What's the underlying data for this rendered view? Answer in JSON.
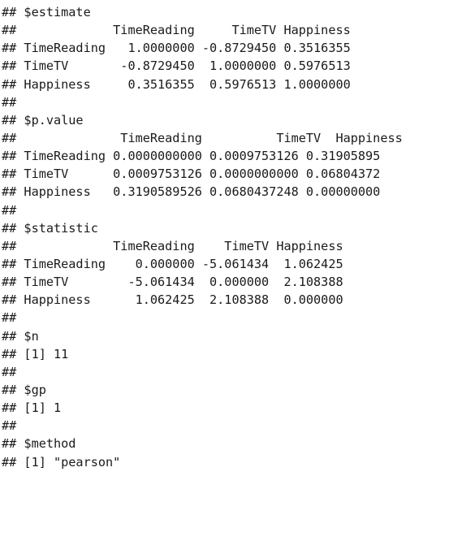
{
  "console": {
    "lines": [
      "## $estimate",
      "##             TimeReading     TimeTV Happiness",
      "## TimeReading   1.0000000 -0.8729450 0.3516355",
      "## TimeTV       -0.8729450  1.0000000 0.5976513",
      "## Happiness     0.3516355  0.5976513 1.0000000",
      "##",
      "## $p.value",
      "##              TimeReading          TimeTV  Happiness",
      "## TimeReading 0.0000000000 0.0009753126 0.31905895",
      "## TimeTV      0.0009753126 0.0000000000 0.06804372",
      "## Happiness   0.3190589526 0.0680437248 0.00000000",
      "##",
      "## $statistic",
      "##             TimeReading    TimeTV Happiness",
      "## TimeReading    0.000000 -5.061434  1.062425",
      "## TimeTV        -5.061434  0.000000  2.108388",
      "## Happiness      1.062425  2.108388  0.000000",
      "##",
      "## $n",
      "## [1] 11",
      "##",
      "## $gp",
      "## [1] 1",
      "##",
      "## $method",
      "## [1] \"pearson\""
    ]
  }
}
